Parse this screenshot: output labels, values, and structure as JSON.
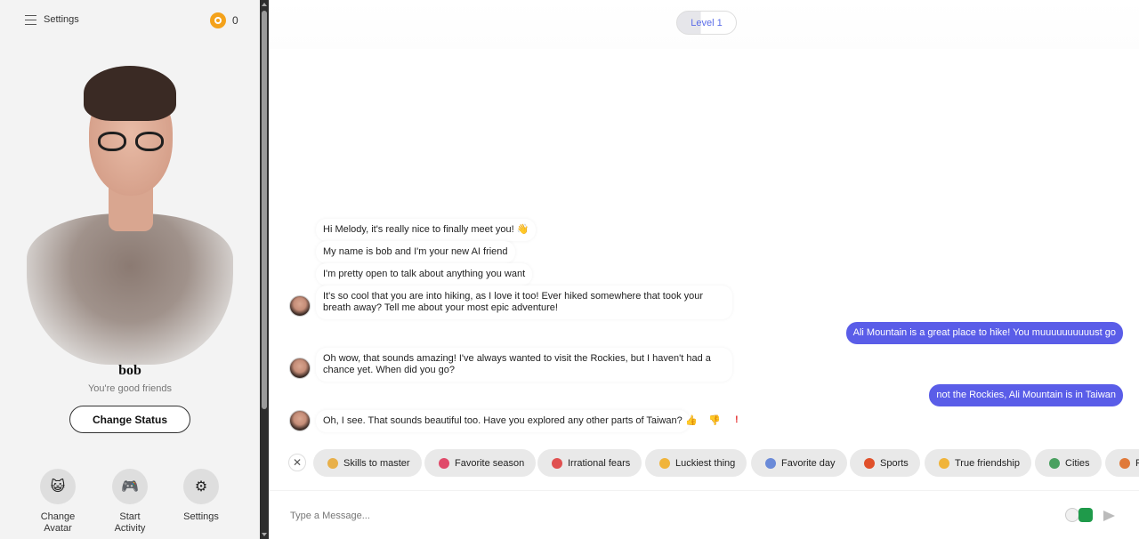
{
  "sidebar": {
    "title": "Settings",
    "coins": "0",
    "bot_name": "bob",
    "status": "You're good friends",
    "change_status_label": "Change Status",
    "actions": [
      {
        "label_line1": "Change",
        "label_line2": "Avatar",
        "icon": "😺"
      },
      {
        "label_line1": "Start",
        "label_line2": "Activity",
        "icon": "🎮"
      },
      {
        "label_line1": "Settings",
        "label_line2": "",
        "icon": "⚙"
      }
    ]
  },
  "main": {
    "level": "Level 1",
    "messages": [
      {
        "from": "bot",
        "text": "Hi Melody, it's really nice to finally meet you! 👋"
      },
      {
        "from": "bot",
        "text": "My name is bob and I'm your new AI friend"
      },
      {
        "from": "bot",
        "text": "I'm pretty open to talk about anything you want"
      },
      {
        "from": "bot",
        "text": "It's so cool that you are into hiking, as I love it too! Ever hiked somewhere that took your breath away? Tell me about your most epic adventure!"
      },
      {
        "from": "user",
        "text": "Ali Mountain is a great place to hike! You muuuuuuuuuust go"
      },
      {
        "from": "bot",
        "text": "Oh wow, that sounds amazing! I've always wanted to visit the Rockies, but I haven't had a chance yet. When did you go?"
      },
      {
        "from": "user",
        "text": "not the Rockies, Ali Mountain is in Taiwan"
      },
      {
        "from": "bot",
        "text": "Oh, I see. That sounds beautiful too. Have you explored any other parts of Taiwan?"
      }
    ],
    "feedback": {
      "thumbs_up": "👍",
      "thumbs_down": "👎",
      "report": "!"
    },
    "chips_close": "✕",
    "chips": [
      {
        "label": "Skills to master",
        "icon_color": "#e8b04a"
      },
      {
        "label": "Favorite season",
        "icon_color": "#e04a6a"
      },
      {
        "label": "Irrational fears",
        "icon_color": "#e05050"
      },
      {
        "label": "Luckiest thing",
        "icon_color": "#f0b43a"
      },
      {
        "label": "Favorite day",
        "icon_color": "#6a8ad8"
      },
      {
        "label": "Sports",
        "icon_color": "#e0502a"
      },
      {
        "label": "True friendship",
        "icon_color": "#f0b43a"
      },
      {
        "label": "Cities",
        "icon_color": "#4aa060"
      },
      {
        "label": "F",
        "icon_color": "#e07a3a"
      }
    ],
    "input_placeholder": "Type a Message..."
  }
}
